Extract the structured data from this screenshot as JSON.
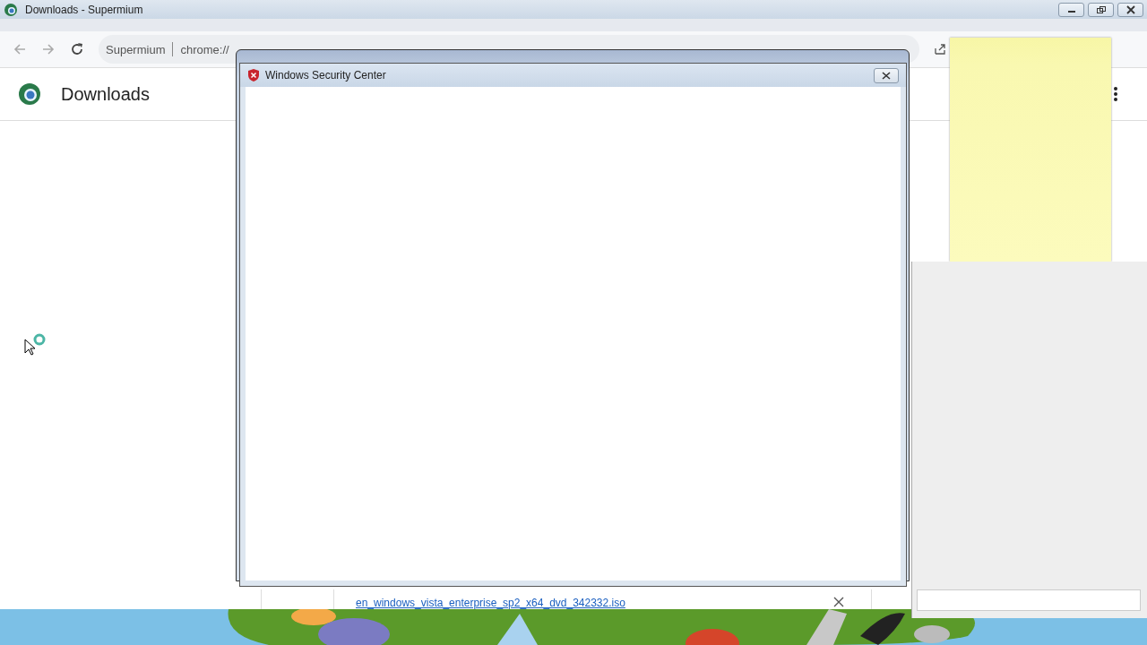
{
  "browser": {
    "title": "Downloads - Supermium",
    "address": {
      "site": "Supermium",
      "url": "chrome://"
    },
    "page_title": "Downloads",
    "download": {
      "file_name": "en_windows_vista_enterprise_sp2_x64_dvd_342332.iso"
    }
  },
  "dialog": {
    "title": "Windows Security Center"
  }
}
